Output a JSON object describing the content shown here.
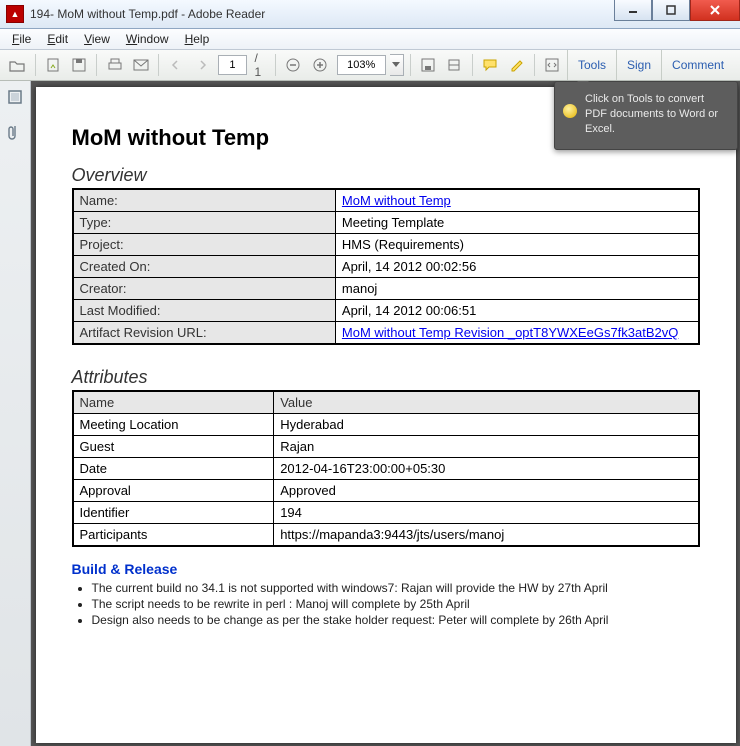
{
  "window": {
    "title": "194- MoM without Temp.pdf - Adobe Reader"
  },
  "menu": {
    "file": "File",
    "edit": "Edit",
    "view": "View",
    "window": "Window",
    "help": "Help"
  },
  "toolbar": {
    "page_current": "1",
    "page_total": "/ 1",
    "zoom": "103%"
  },
  "rightpanel": {
    "tools": "Tools",
    "sign": "Sign",
    "comment": "Comment"
  },
  "tooltip": {
    "text": "Click on Tools to convert PDF documents to Word or Excel."
  },
  "doc": {
    "title": "MoM without Temp",
    "overview_heading": "Overview",
    "overview": {
      "name_label": "Name:",
      "name_value": "MoM without Temp",
      "type_label": "Type:",
      "type_value": "Meeting Template",
      "project_label": "Project:",
      "project_value": "HMS (Requirements)",
      "created_label": "Created On:",
      "created_value": "April, 14 2012 00:02:56",
      "creator_label": "Creator:",
      "creator_value": "manoj",
      "modified_label": "Last Modified:",
      "modified_value": "April, 14 2012 00:06:51",
      "revurl_label": "Artifact Revision URL:",
      "revurl_value": "MoM without Temp Revision _optT8YWXEeGs7fk3atB2vQ"
    },
    "attributes_heading": "Attributes",
    "attributes": {
      "header_name": "Name",
      "header_value": "Value",
      "rows": [
        {
          "name": "Meeting Location",
          "value": "Hyderabad"
        },
        {
          "name": "Guest",
          "value": "Rajan"
        },
        {
          "name": "Date",
          "value": "2012-04-16T23:00:00+05:30"
        },
        {
          "name": "Approval",
          "value": "Approved"
        },
        {
          "name": "Identifier",
          "value": "194"
        },
        {
          "name": "Participants",
          "value": "https://mapanda3:9443/jts/users/manoj"
        }
      ]
    },
    "build_heading": "Build & Release",
    "notes": [
      "The current build no 34.1 is not supported with windows7:   Rajan will provide the HW by 27th April",
      "The script needs to be rewrite in perl : Manoj will complete by 25th April",
      "Design also needs to be change as per the stake holder request: Peter will complete by 26th April"
    ]
  }
}
